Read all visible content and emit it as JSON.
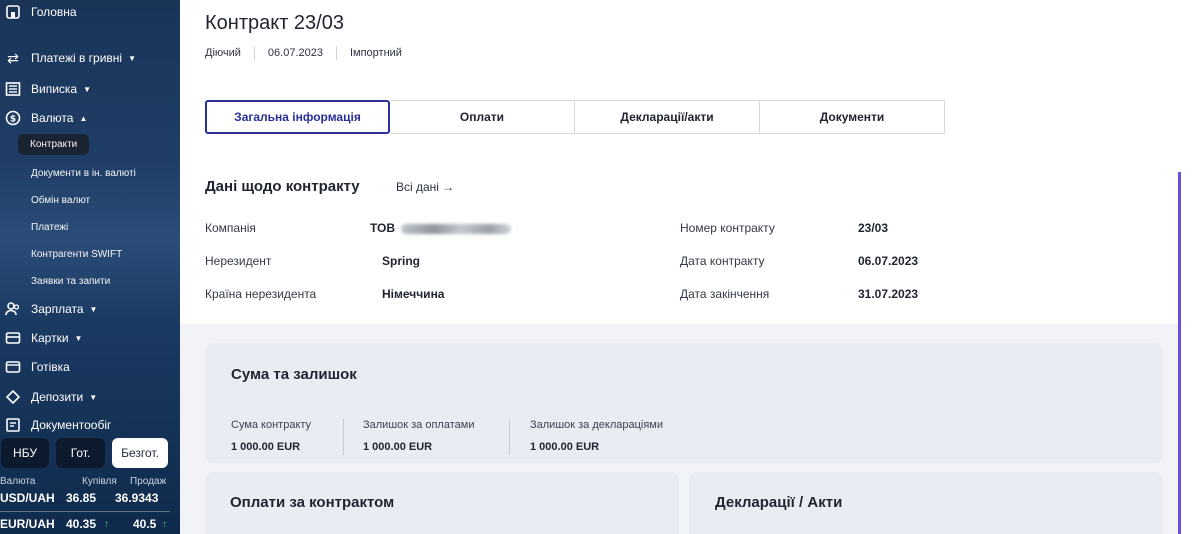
{
  "sidebar": {
    "home": "Головна",
    "payments_uah": "Платежі в гривні",
    "statement": "Виписка",
    "currency": "Валюта",
    "sub": {
      "contracts": "Контракти",
      "docs_foreign": "Документи в ін. валюті",
      "exchange": "Обмін валют",
      "payments": "Платежі",
      "swift": "Контрагенти SWIFT",
      "requests": "Заявки та запити"
    },
    "salary": "Зарплата",
    "cards": "Картки",
    "cash": "Готівка",
    "deposits": "Депозити",
    "docflow": "Документообіг",
    "rate_tabs": [
      "НБУ",
      "Гот.",
      "Безгот."
    ],
    "rate_head": {
      "currency": "Валюта",
      "buy": "Купівля",
      "sell": "Продаж"
    },
    "rates": [
      {
        "pair": "USD/UAH",
        "buy": "36.85",
        "sell": "36.9343",
        "arrow": ""
      },
      {
        "pair": "EUR/UAH",
        "buy": "40.35",
        "sell": "40.5",
        "arrow": "↑"
      }
    ]
  },
  "main": {
    "title": "Контракт 23/03",
    "status": "Діючий",
    "date": "06.07.2023",
    "type": "Імпортний",
    "tabs": [
      "Загальна інформація",
      "Оплати",
      "Декларації/акти",
      "Документи"
    ],
    "section_title": "Дані щодо контракту",
    "all_data": "Всі дані →",
    "fields_left": [
      {
        "label": "Компанія",
        "value": "ТОВ"
      },
      {
        "label": "Нерезидент",
        "value": "Spring"
      },
      {
        "label": "Країна нерезидента",
        "value": "Німеччина"
      }
    ],
    "fields_right": [
      {
        "label": "Номер контракту",
        "value": "23/03"
      },
      {
        "label": "Дата контракту",
        "value": "06.07.2023"
      },
      {
        "label": "Дата закінчення",
        "value": "31.07.2023"
      }
    ],
    "summary": {
      "title": "Сума та залишок",
      "cols": [
        {
          "label": "Сума контракту",
          "value": "1 000.00 EUR"
        },
        {
          "label": "Залишок за оплатами",
          "value": "1 000.00 EUR"
        },
        {
          "label": "Залишок за деклараціями",
          "value": "1 000.00 EUR"
        }
      ]
    },
    "payments_card_title": "Оплати за контрактом",
    "decl_card_title": "Декларації / Акти"
  }
}
